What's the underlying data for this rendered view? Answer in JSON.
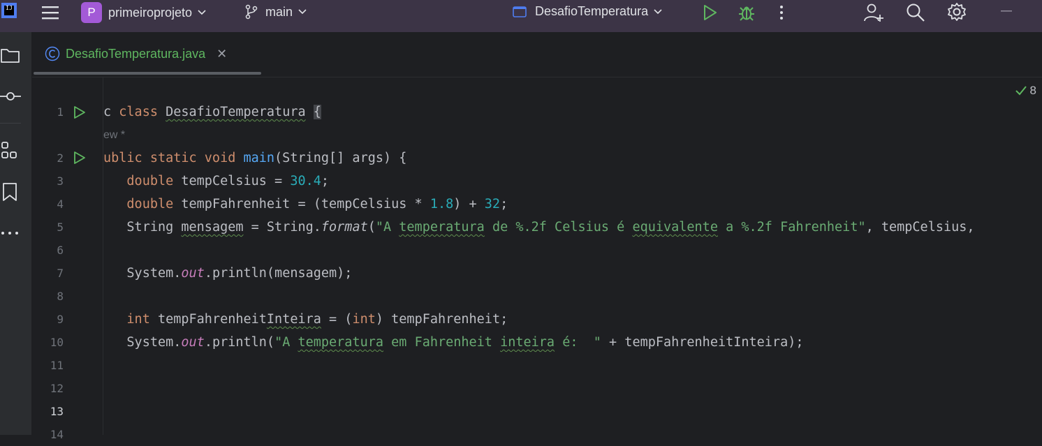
{
  "titlebar": {
    "project_badge": "P",
    "project_name": "primeiroprojeto",
    "branch": "main",
    "run_config": "DesafioTemperatura"
  },
  "editor": {
    "tab_label": "DesafioTemperatura.java",
    "inspection_count": "8",
    "inlay_hint": "ew *",
    "active_line": 13
  },
  "code": {
    "line1": {
      "pre": "c ",
      "kw": "class",
      "sp": " ",
      "cls": "DesafioTemperatura",
      "sp2": " ",
      "brace": "{"
    },
    "line2": {
      "pre": "ublic static void ",
      "fn": "main",
      "rest": "(String[] args) {"
    },
    "line3": {
      "indent": "   ",
      "kw": "double",
      "mid": " tempCelsius = ",
      "num": "30.4",
      "end": ";"
    },
    "line4": {
      "indent": "   ",
      "kw": "double",
      "mid": " tempFahrenheit = (tempCelsius * ",
      "num1": "1.8",
      "mid2": ") + ",
      "num2": "32",
      "end": ";"
    },
    "line5": {
      "indent": "   ",
      "pre": "String ",
      "var": "mensagem",
      "mid": " = String.",
      "fmt": "format",
      "paren": "(",
      "s1": "\"A ",
      "s2": "temperatura",
      "s3": " de %.2f Celsius é ",
      "s4": "equivalente",
      "s5": " a %.2f Fahrenheit\"",
      "end": ", tempCelsius,"
    },
    "line7": {
      "indent": "   ",
      "pre": "System.",
      "stat": "out",
      "end": ".println(mensagem);"
    },
    "line9": {
      "indent": "   ",
      "kw": "int",
      "mid": " tempFahrenheit",
      "sq": "Inteira",
      "mid2": " = (",
      "kw2": "int",
      "end": ") tempFahrenheit;"
    },
    "line10": {
      "indent": "   ",
      "pre": "System.",
      "stat": "out",
      "mid": ".println(",
      "s1": "\"A ",
      "s2": "temperatura",
      "s3": " em Fahrenheit ",
      "s4": "inteira",
      "s5": " é:  \"",
      "end": " + tempFahrenheitInteira);"
    }
  },
  "line_numbers": [
    "1",
    "2",
    "3",
    "4",
    "5",
    "6",
    "7",
    "8",
    "9",
    "10",
    "11",
    "12",
    "13",
    "14"
  ],
  "colors": {
    "titlebar_bg": "#3c3446",
    "editor_bg": "#1e1f22",
    "keyword": "#cf8e6d",
    "function": "#56a8f5",
    "number": "#2aacb8",
    "string": "#6aab73",
    "static_field": "#c77dbb",
    "run_green": "#5fb760"
  },
  "icons": [
    "jetbrains-logo-icon",
    "hamburger-menu-icon",
    "chevron-down-icon",
    "branch-icon",
    "run-config-icon",
    "run-icon",
    "debug-icon",
    "more-vertical-icon",
    "add-user-icon",
    "search-icon",
    "gear-icon",
    "minimize-icon",
    "folder-icon",
    "commit-icon",
    "structure-icon",
    "bookmark-icon",
    "more-horizontal-icon",
    "java-class-icon",
    "close-icon",
    "check-icon",
    "run-gutter-icon"
  ]
}
